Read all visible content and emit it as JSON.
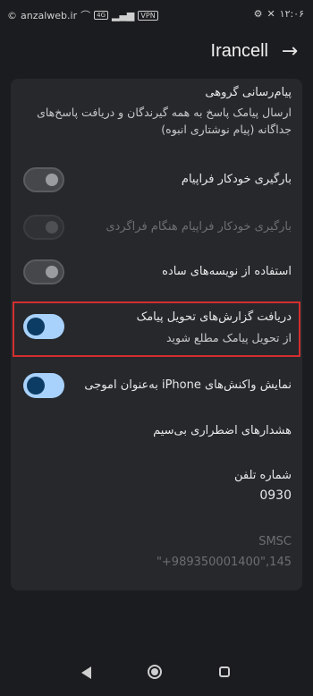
{
  "status_bar": {
    "watermark": "anzalweb.ir",
    "time": "۱۲:۰۶",
    "vpn": "VPN"
  },
  "header": {
    "title": "Irancell"
  },
  "settings": {
    "group_messaging": {
      "title": "پیام‌رسانی گروهی",
      "subtitle": "ارسال پیامک پاسخ به همه گیرندگان و دریافت پاسخ‌های جداگانه (پیام نوشتاری انبوه)"
    },
    "auto_download_mms": {
      "label": "بارگیری خودکار فراپیام",
      "enabled": false
    },
    "auto_download_roaming": {
      "label": "بارگیری خودکار فراپیام هنگام فراگردی",
      "enabled": false,
      "disabled": true
    },
    "simple_chars": {
      "label": "استفاده از نویسه‌های ساده",
      "enabled": false
    },
    "delivery_reports": {
      "title": "دریافت گزارش‌های تحویل پیامک",
      "subtitle": "از تحویل پیامک مطلع شوید",
      "enabled": true
    },
    "iphone_reactions": {
      "label": "نمایش واکنش‌های iPhone به‌عنوان اموجی",
      "enabled": true
    },
    "emergency_alerts": {
      "label": "هشدارهای اضطراری بی‌سیم"
    },
    "phone_number": {
      "label": "شماره تلفن",
      "value": "0930"
    },
    "smsc": {
      "label": "SMSC",
      "value": "\"+989350001400\",145"
    }
  }
}
